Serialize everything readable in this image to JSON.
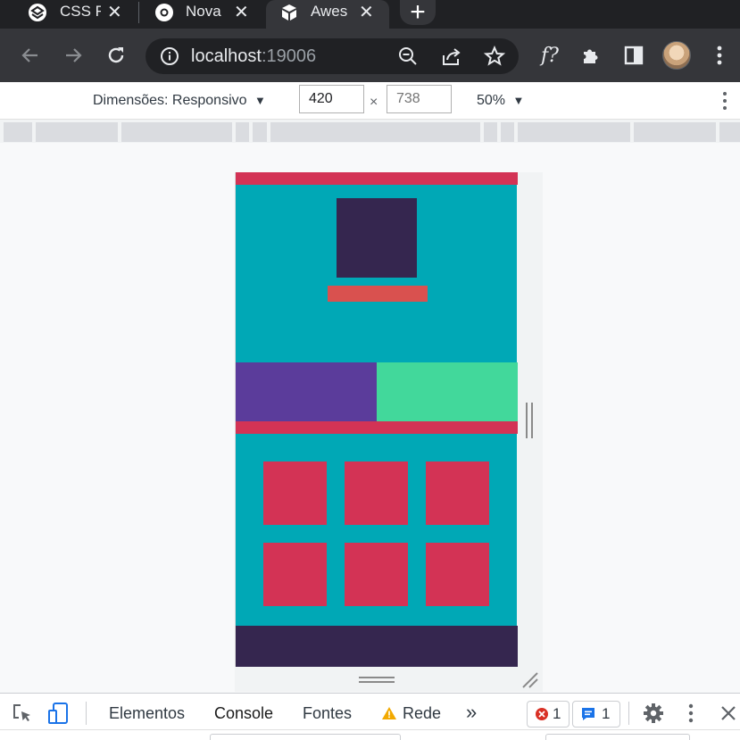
{
  "browser": {
    "tabs": [
      {
        "title": "CSS F",
        "icon": "codepen-icon"
      },
      {
        "title": "Nova",
        "icon": "chrome-icon"
      },
      {
        "title": "Awes",
        "icon": "cube-icon",
        "active": true
      }
    ],
    "address": {
      "host": "localhost",
      "port": ":19006"
    }
  },
  "device_toolbar": {
    "dimensions_label": "Dimensões: Responsivo",
    "width": "420",
    "times": "×",
    "height_placeholder": "738",
    "zoom": "50%"
  },
  "site_colors": {
    "background": "#00a8b6",
    "stripe": "#d33355",
    "dark": "#35264f",
    "logo_bar": "#d9514f",
    "purple": "#5b3c9b",
    "green": "#42d89b",
    "tile": "#d33355"
  },
  "drawer": {
    "tabs": [
      "Elementos",
      "Console",
      "Fontes",
      "Rede"
    ],
    "active_tab": "Console",
    "error_count": "1",
    "message_count": "1",
    "more": "»"
  }
}
